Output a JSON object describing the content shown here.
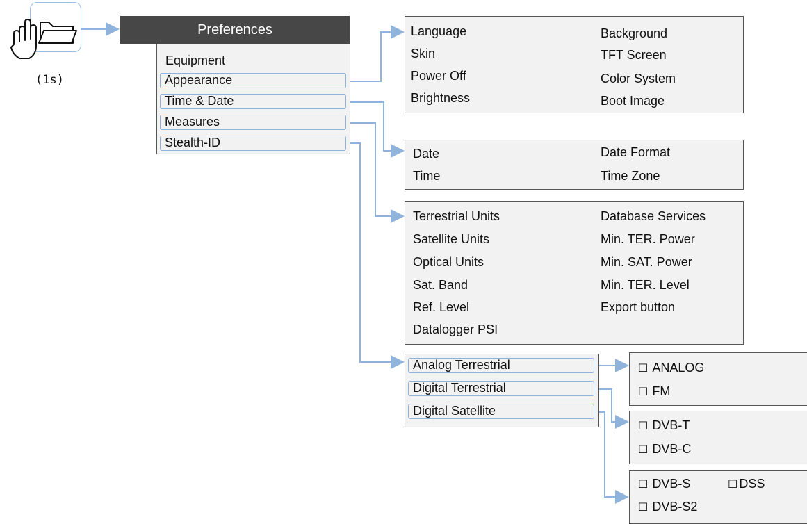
{
  "launcher": {
    "icon": "folder-icon",
    "gesture_icon": "hand-press-icon",
    "hold_label": "(1s)"
  },
  "preferences": {
    "title": "Preferences",
    "items": [
      "Equipment",
      "Appearance",
      "Time & Date",
      "Measures",
      "Stealth-ID"
    ]
  },
  "appearance_panel": {
    "left": [
      "Language",
      "Skin",
      "Power Off",
      "Brightness"
    ],
    "right": [
      "Background",
      "TFT Screen",
      "Color System",
      "Boot Image"
    ]
  },
  "time_date_panel": {
    "left": [
      "Date",
      "Time"
    ],
    "right": [
      "Date Format",
      "Time Zone"
    ]
  },
  "measures_panel": {
    "left": [
      "Terrestrial Units",
      "Satellite Units",
      "Optical Units",
      "Sat. Band",
      "Ref. Level",
      "Datalogger PSI"
    ],
    "right": [
      "Database Services",
      "Min. TER. Power",
      "Min. SAT. Power",
      "Min. TER. Level",
      "Export button"
    ]
  },
  "stealth_panel": {
    "items": [
      "Analog Terrestrial",
      "Digital Terrestrial",
      "Digital Satellite"
    ]
  },
  "analog_options": {
    "checkbox": "☐",
    "items": [
      "ANALOG",
      "FM"
    ]
  },
  "digital_terrestrial_options": {
    "checkbox": "☐",
    "items": [
      "DVB-T",
      "DVB-C"
    ]
  },
  "digital_satellite_options": {
    "checkbox": "☐",
    "items": [
      "DVB-S",
      "DVB-S2",
      "DSS"
    ]
  },
  "colors": {
    "connector": "#8fb3da",
    "header_bg": "#474747",
    "panel_bg": "#f2f2f2"
  }
}
